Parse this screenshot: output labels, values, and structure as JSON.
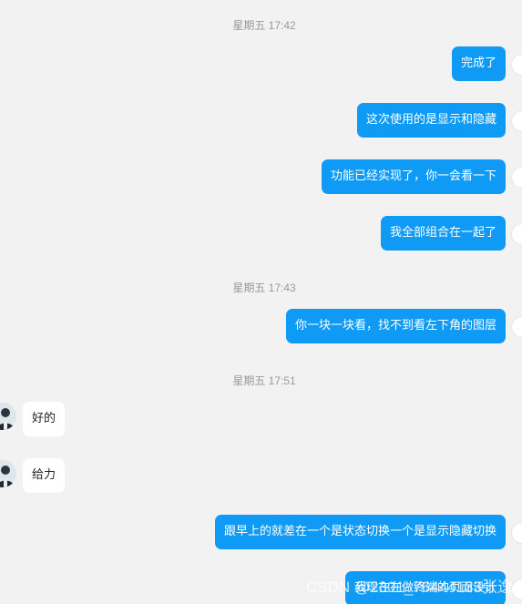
{
  "timestamps": [
    "星期五 17:42",
    "星期五 17:43",
    "星期五 17:51"
  ],
  "messages": {
    "m1": "完成了",
    "m2": "这次使用的是显示和隐藏",
    "m3": "功能已经实现了，你一会看一下",
    "m4": "我全部组合在一起了",
    "m5": "你一块一块看，找不到看左下角的图层",
    "m6": "好的",
    "m7": "给力",
    "m8": "跟早上的就差在一个是状态切换一个是显示隐藏切换",
    "m9": "我现在在做终端的页面设计"
  },
  "watermark": "CSDN @2301_76444133张逸",
  "colors": {
    "outgoing_bubble": "#0f9bf5",
    "incoming_bubble": "#ffffff",
    "background": "#f2f2f2"
  }
}
